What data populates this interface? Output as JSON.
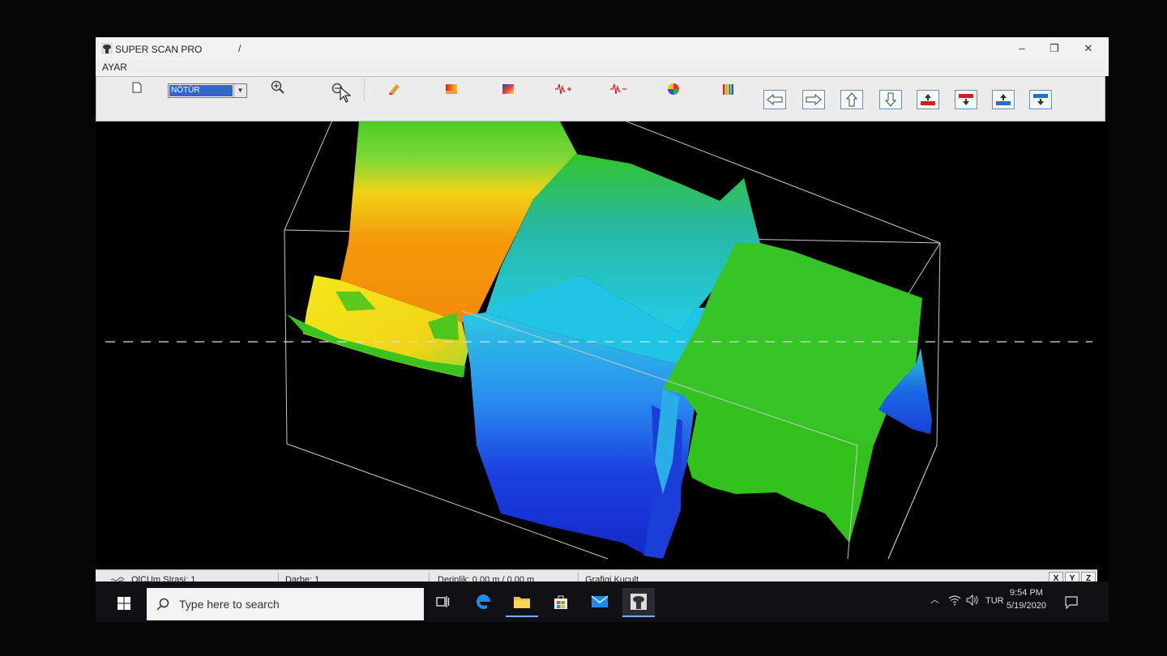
{
  "window": {
    "title": "SUPER SCAN PRO",
    "title_separator": "/",
    "minimize_label": "–",
    "restore_label": "❐",
    "close_label": "✕"
  },
  "menu": {
    "items": [
      {
        "label": "AYAR"
      }
    ]
  },
  "toolbar": {
    "mode_select_value": "NÖTÜR",
    "icons": [
      "new-document-icon",
      "zoom-in-icon",
      "zoom-out-icon",
      "color-palette-icon",
      "gradient-icon",
      "color-map-icon",
      "signal-plus-icon",
      "signal-minus-icon",
      "color-wheel-icon",
      "color-bars-icon",
      "arrow-left-icon",
      "arrow-right-icon",
      "arrow-up-icon",
      "arrow-down-icon",
      "raise-red-icon",
      "lower-red-icon",
      "raise-blue-icon",
      "lower-blue-icon"
    ]
  },
  "status": {
    "olcum_label": "OlCUm SIrasi: 1",
    "darbe_label": "Darbe: 1",
    "derinlik_label": "Derinlik: 0.00 m / 0.00 m",
    "mode_label": "Grafigi Kucult",
    "axis_x": "X",
    "axis_y": "Y",
    "axis_z": "Z"
  },
  "taskbar": {
    "search_placeholder": "Type here to search",
    "language": "TUR",
    "time": "9:54 PM",
    "date": "5/19/2020"
  },
  "colors": {
    "scan_green": "#33c41c",
    "scan_yellow": "#f5e21a",
    "scan_orange": "#f59a0a",
    "scan_cyan": "#23c6e8",
    "scan_blue": "#1a3fdc",
    "taskbar": "#101014"
  }
}
